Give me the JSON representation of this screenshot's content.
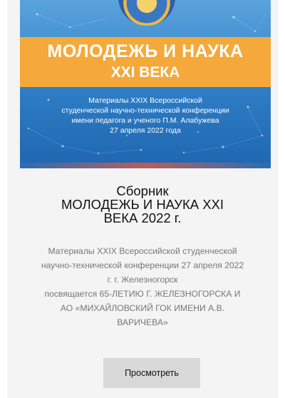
{
  "cover": {
    "title_line1": "МОЛОДЕЖЬ И НАУКА",
    "title_line2": "XXI ВЕКА",
    "sub_lines": [
      "Материалы XXIX Всероссийской",
      "студенческой научно-технической конференции",
      "имени педагога и ученого П.М. Алабужева",
      "27 апреля 2022 года"
    ]
  },
  "card": {
    "title_lines": [
      "Сборник",
      "МОЛОДЕЖЬ И НАУКА XXI",
      "ВЕКА 2022 г."
    ],
    "description_lines": [
      "Материалы XXIX Всероссийской студенческой",
      "научно-технической конференции 27 апреля 2022",
      "г. г. Железногорск",
      "посвящается 65-ЛЕТИЮ Г. ЖЕЛЕЗНОГОРСКА И",
      "АО «МИХАЙЛОВСКИЙ ГОК ИМЕНИ А.В.",
      "ВАРИЧЕВА»"
    ],
    "button_label": "Просмотреть"
  },
  "colors": {
    "accent_band": "#f4a93a",
    "cover_blue": "#2d7cc4",
    "button_bg": "#d8d8d8"
  }
}
